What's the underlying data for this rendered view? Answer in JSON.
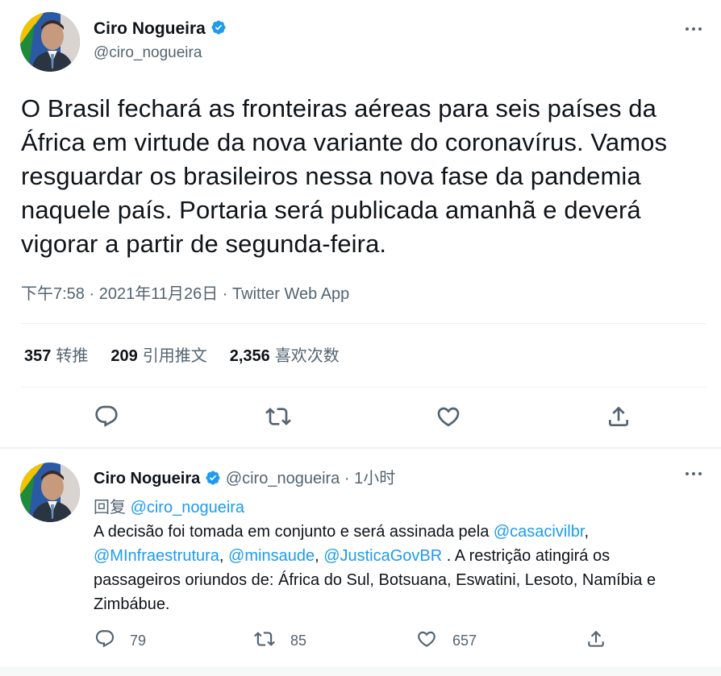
{
  "main_tweet": {
    "display_name": "Ciro Nogueira",
    "handle": "@ciro_nogueira",
    "text": "O Brasil fechará as fronteiras aéreas para seis países da África em virtude da nova variante do coronavírus. Vamos resguardar os brasileiros nessa nova fase da pandemia naquele país. Portaria será publicada amanhã e deverá vigorar a partir de segunda-feira.",
    "time": "下午7:58",
    "date": "2021年11月26日",
    "separator": "·",
    "source": "Twitter Web App",
    "stats": {
      "retweets_count": "357",
      "retweets_label": "转推",
      "quotes_count": "209",
      "quotes_label": "引用推文",
      "likes_count": "2,356",
      "likes_label": "喜欢次数"
    },
    "icons": [
      "reply-icon",
      "retweet-icon",
      "like-icon",
      "share-icon",
      "more-icon",
      "verified-icon"
    ]
  },
  "reply_tweet": {
    "display_name": "Ciro Nogueira",
    "handle": "@ciro_nogueira",
    "separator": "·",
    "time_ago": "1小时",
    "replying_label": "回复",
    "replying_to": "@ciro_nogueira",
    "text_part1": "A decisão foi tomada em conjunto e será assinada pela ",
    "mention1": "@casacivilbr",
    "text_part2": ", ",
    "mention2": "@MInfraestrutura",
    "text_part3": ", ",
    "mention3": "@minsaude",
    "text_part4": ", ",
    "mention4": "@JusticaGovBR",
    "text_part5": " . A restrição atingirá os passageiros oriundos de:  África do Sul, Botsuana, Eswatini, Lesoto, Namíbia e Zimbábue.",
    "reply_count": "79",
    "retweet_count": "85",
    "like_count": "657"
  },
  "colors": {
    "accent": "#1d9bf0",
    "text_primary": "#0f1419",
    "text_secondary": "#536471",
    "divider": "#eff3f4"
  }
}
